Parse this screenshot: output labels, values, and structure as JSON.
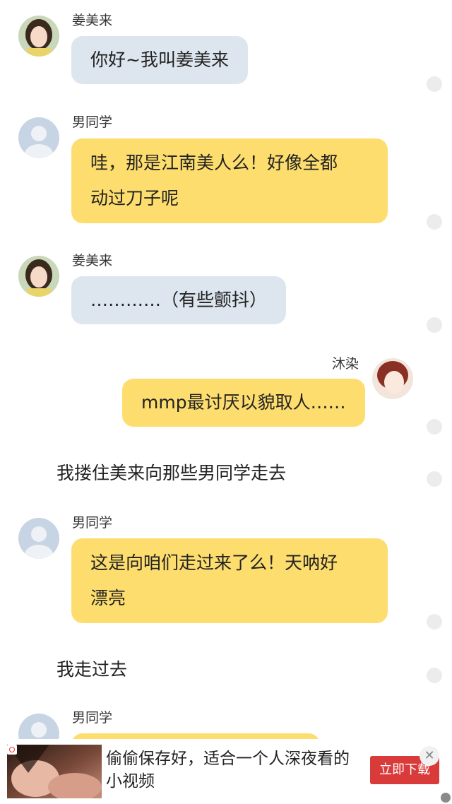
{
  "messages": [
    {
      "sender": "姜美来",
      "text": "你好~我叫姜美来"
    },
    {
      "sender": "男同学",
      "line1": "哇，那是江南美人么！好像全都",
      "line2": "动过刀子呢"
    },
    {
      "sender": "姜美来",
      "text": "…………（有些颤抖）"
    },
    {
      "sender": "沐染",
      "text": "mmp最讨厌以貌取人……"
    },
    {
      "sender": "男同学",
      "line1": "这是向咱们走过来了么！天呐好",
      "line2": "漂亮"
    },
    {
      "sender": "男同学"
    }
  ],
  "narrations": [
    "我搂住美来向那些男同学走去",
    "我走过去"
  ],
  "ad": {
    "text": "偷偷保存好，适合一个人深夜看的小视频",
    "button_label": "立即下载",
    "close_label": "✕"
  },
  "colors": {
    "bubble_grey": "#dde6ee",
    "bubble_yellow": "#fddd6e",
    "ad_button": "#d93b3b"
  }
}
